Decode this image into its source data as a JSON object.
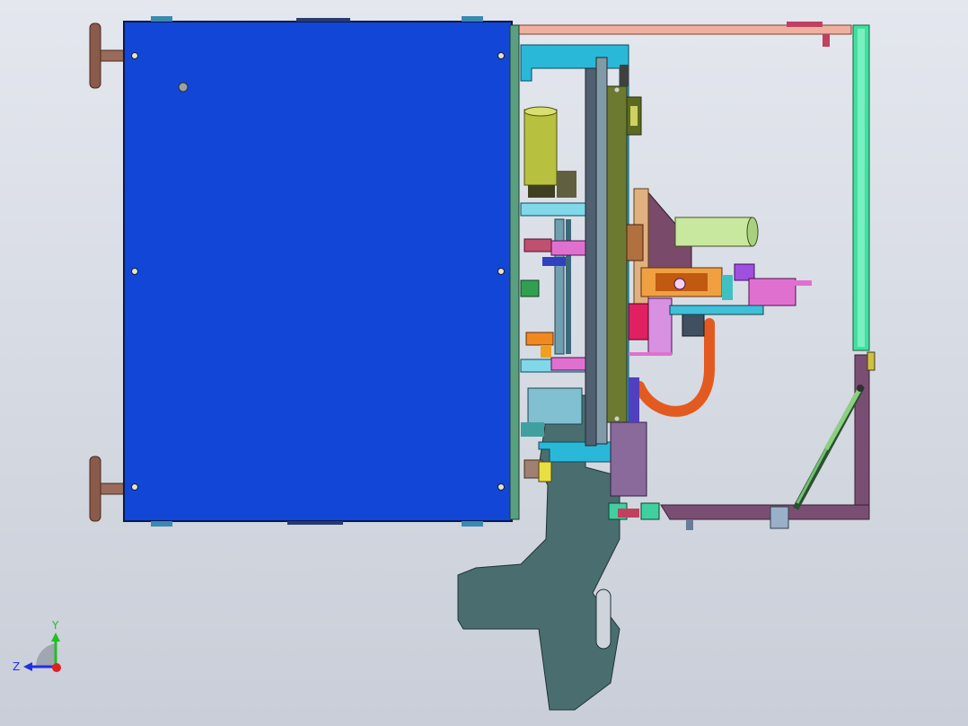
{
  "scene": {
    "background_top": "#e4e7ee",
    "background_bottom": "#c9ced8",
    "colors": {
      "cabinet_blue": "#1146d6",
      "mount_plate": "#4a6e70",
      "handle_copper": "#9a6a5a",
      "frame_purple": "#7a4e72",
      "rail_green": "#3fe0a0",
      "top_rail_pink": "#f0b0a0",
      "cable_orange": "#e35a20",
      "cyan_bracket": "#2ab8d8",
      "olive_motor": "#b8c040",
      "olive_board": "#6b7a30",
      "magenta_part": "#e070d0",
      "light_green_cyl": "#c8e8a0"
    }
  },
  "axis_triad": {
    "y_label": "Y",
    "z_label": "Z",
    "x_color": "#e02020",
    "y_color": "#20c020",
    "z_color": "#2030e0"
  }
}
